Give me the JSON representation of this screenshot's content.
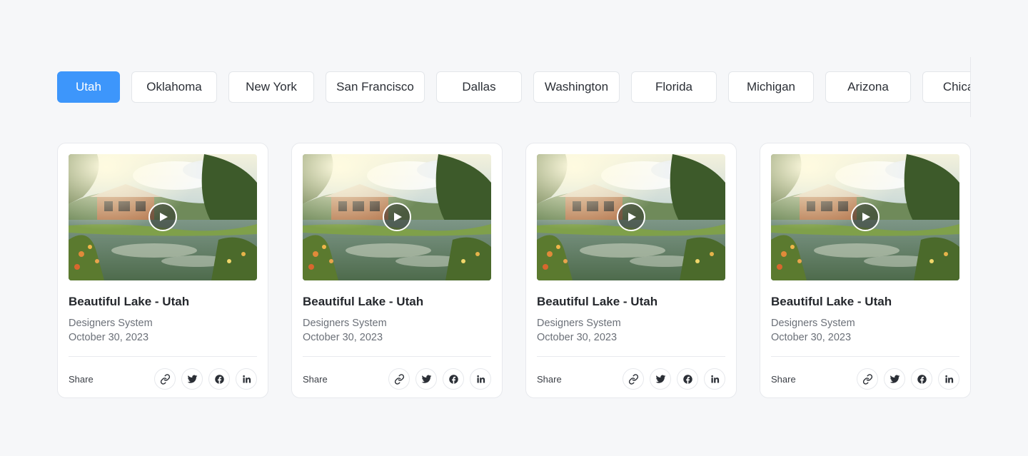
{
  "tabs": [
    {
      "label": "Utah",
      "active": true
    },
    {
      "label": "Oklahoma",
      "active": false
    },
    {
      "label": "New York",
      "active": false
    },
    {
      "label": "San Francisco",
      "active": false
    },
    {
      "label": "Dallas",
      "active": false
    },
    {
      "label": "Washington",
      "active": false
    },
    {
      "label": "Florida",
      "active": false
    },
    {
      "label": "Michigan",
      "active": false
    },
    {
      "label": "Arizona",
      "active": false
    },
    {
      "label": "Chicago",
      "active": false
    }
  ],
  "colors": {
    "accent": "#3d96fb",
    "background": "#f6f7f9",
    "card": "#ffffff"
  },
  "cards": [
    {
      "title": "Beautiful Lake - Utah",
      "author": "Designers System",
      "date": "October 30, 2023",
      "share_label": "Share",
      "media": "video-thumbnail-lake-cabin"
    },
    {
      "title": "Beautiful Lake - Utah",
      "author": "Designers System",
      "date": "October 30, 2023",
      "share_label": "Share",
      "media": "video-thumbnail-lake-cabin"
    },
    {
      "title": "Beautiful Lake - Utah",
      "author": "Designers System",
      "date": "October 30, 2023",
      "share_label": "Share",
      "media": "video-thumbnail-lake-cabin"
    },
    {
      "title": "Beautiful Lake - Utah",
      "author": "Designers System",
      "date": "October 30, 2023",
      "share_label": "Share",
      "media": "video-thumbnail-lake-cabin"
    }
  ],
  "share_icons": [
    "link-icon",
    "twitter-icon",
    "facebook-icon",
    "linkedin-icon"
  ],
  "play_icon": "play-icon"
}
